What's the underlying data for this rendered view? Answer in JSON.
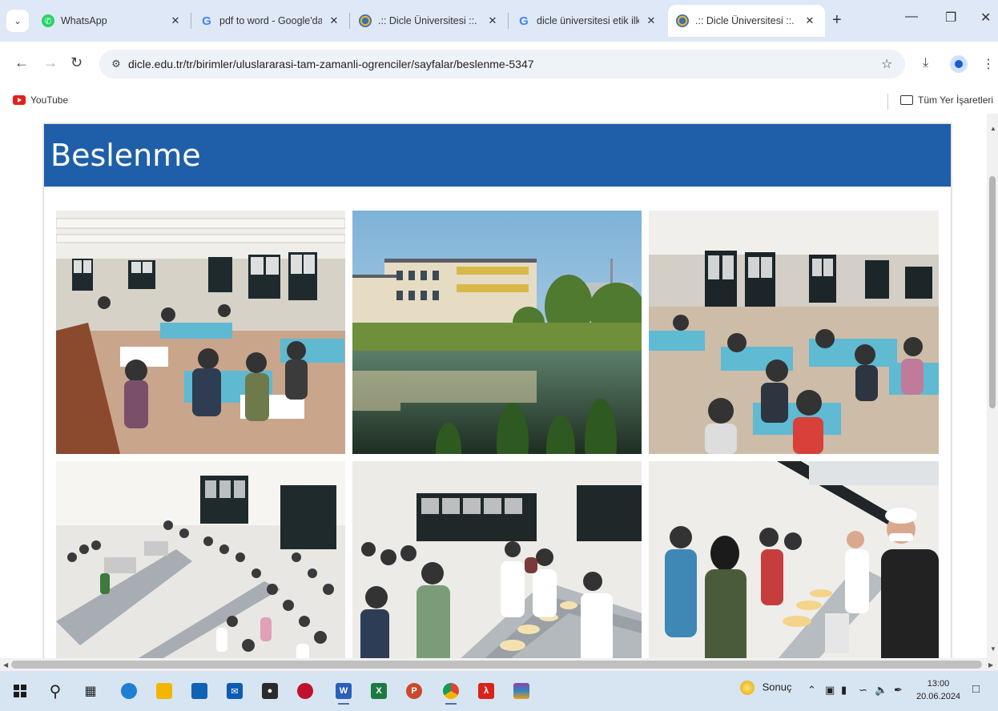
{
  "browser": {
    "tabs": [
      {
        "title": "WhatsApp",
        "icon": "whatsapp-icon",
        "active": false
      },
      {
        "title": "pdf to word - Google'da",
        "icon": "google-icon",
        "active": false
      },
      {
        "title": ".:: Dicle Üniversitesi ::.",
        "icon": "dicle-logo-icon",
        "active": false
      },
      {
        "title": "dicle üniversitesi etik ilke",
        "icon": "google-icon",
        "active": false
      },
      {
        "title": ".:: Dicle Üniversitesi ::.",
        "icon": "dicle-logo-icon",
        "active": true
      }
    ],
    "url": "dicle.edu.tr/tr/birimler/uluslararasi-tam-zamanli-ogrenciler/sayfalar/beslenme-5347",
    "bookmarks": {
      "youtube": "YouTube",
      "all_bookmarks": "Tüm Yer İşaretleri"
    }
  },
  "page": {
    "title": "Beslenme",
    "header_color": "#1f5ea8",
    "photos": [
      {
        "name": "dining-hall-photo-1",
        "subject": "students eating at tables in dining hall"
      },
      {
        "name": "campus-pond-photo",
        "subject": "university building reflected in pond"
      },
      {
        "name": "dining-hall-photo-2",
        "subject": "crowded dining hall with students"
      },
      {
        "name": "cafeteria-line-photo-1",
        "subject": "students queueing at cafeteria counters, top view"
      },
      {
        "name": "cafeteria-line-photo-2",
        "subject": "students receiving food at serving line"
      },
      {
        "name": "cafeteria-line-photo-3",
        "subject": "staff serving food to students"
      }
    ]
  },
  "taskbar": {
    "weather_label": "Sonuç",
    "time": "13:00",
    "date": "20.06.2024"
  }
}
